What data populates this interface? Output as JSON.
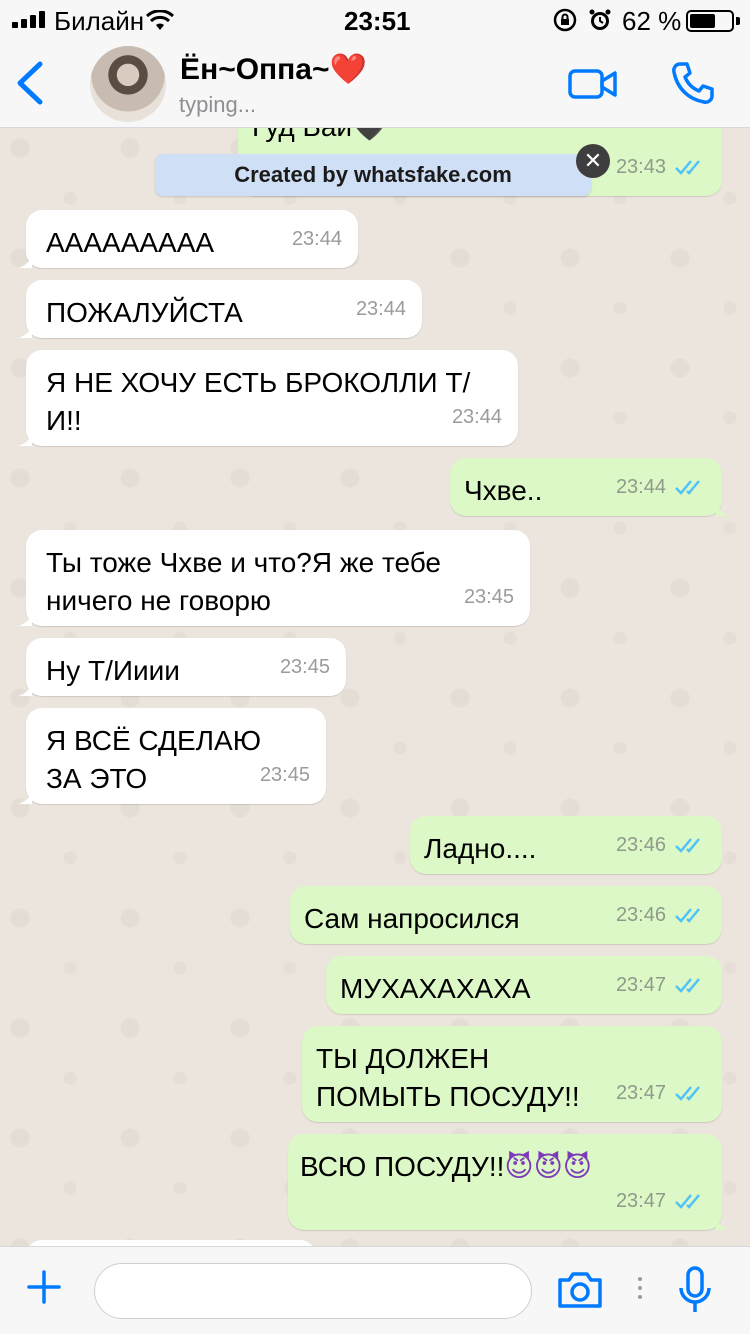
{
  "status": {
    "carrier": "Билайн",
    "time": "23:51",
    "battery_pct": "62 %",
    "battery_level": 0.62
  },
  "header": {
    "contact_name": "Ён~Оппа~",
    "contact_heart": "❤️",
    "contact_status": "typing..."
  },
  "colors": {
    "accent": "#007aff",
    "bubble_out": "#dcf8c6",
    "bubble_in": "#ffffff",
    "tick": "#4fc3f7"
  },
  "watermark": {
    "text": "Created by whatsfake.com",
    "close": "✕"
  },
  "messages": [
    {
      "side": "out",
      "text": "Гуд Бай🖤",
      "time": "23:43",
      "read": true
    },
    {
      "side": "in",
      "text": "ААААААААА",
      "time": "23:44"
    },
    {
      "side": "in",
      "text": "ПОЖАЛУЙСТА",
      "time": "23:44"
    },
    {
      "side": "in",
      "text": "Я НЕ ХОЧУ ЕСТЬ БРОКОЛЛИ Т/И!!",
      "time": "23:44"
    },
    {
      "side": "out",
      "text": "Чхве..",
      "time": "23:44",
      "read": true
    },
    {
      "side": "in",
      "text": "Ты тоже Чхве и что?Я же тебе ничего не говорю",
      "time": "23:45"
    },
    {
      "side": "in",
      "text": "Ну Т/Ииии",
      "time": "23:45"
    },
    {
      "side": "in",
      "text": "Я ВСЁ СДЕЛАЮ ЗА ЭТО",
      "time": "23:45"
    },
    {
      "side": "out",
      "text": "Ладно....",
      "time": "23:46",
      "read": true
    },
    {
      "side": "out",
      "text": "Сам напросился",
      "time": "23:46",
      "read": true
    },
    {
      "side": "out",
      "text": "МУХАХАХАХА",
      "time": "23:47",
      "read": true
    },
    {
      "side": "out",
      "text": "ТЫ ДОЛЖЕН ПОМЫТЬ ПОСУДУ!!",
      "time": "23:47",
      "read": true
    },
    {
      "side": "out",
      "text": "ВСЮ ПОСУДУ!!",
      "emoji": "😈😈😈",
      "time": "23:47",
      "read": true
    }
  ],
  "input": {
    "placeholder": ""
  },
  "icons": [
    "back-chevron-icon",
    "video-camera-icon",
    "phone-icon",
    "plus-icon",
    "camera-icon",
    "microphone-icon",
    "double-check-icon"
  ]
}
